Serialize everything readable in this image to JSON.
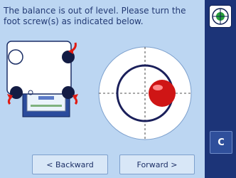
{
  "instruction": "The balance is out of level. Please turn the foot screw(s) as indicated below.",
  "buttons": {
    "backward": "< Backward",
    "forward": "Forward >",
    "clear": "C"
  },
  "icons": {
    "level_indicator": "level-indicator-icon",
    "balance_diagram": "balance-feet-diagram",
    "bubble_level": "bubble-level"
  },
  "colors": {
    "panel_bg": "#bcd6f2",
    "sidebar_bg": "#1c3478",
    "text": "#233a74",
    "turn_arrow": "#e11b12",
    "bubble": "#cf1515"
  }
}
